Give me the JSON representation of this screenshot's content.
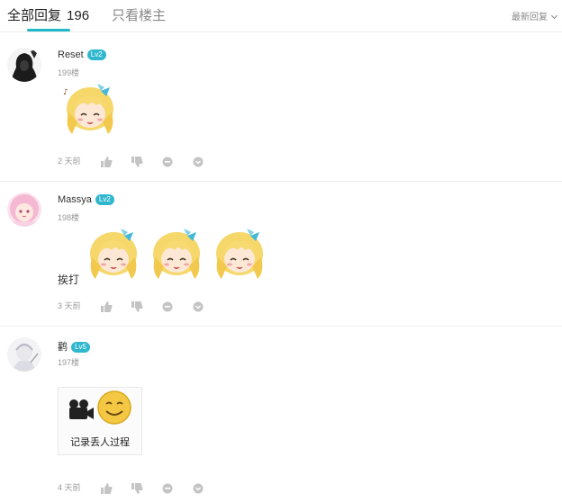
{
  "tabs": {
    "all_label": "全部回复",
    "all_count": "196",
    "owner_only_label": "只看楼主"
  },
  "sort": {
    "label": "最新回复"
  },
  "colors": {
    "accent": "#22b8c8",
    "level_badge": "#2fb7cf"
  },
  "replies": [
    {
      "username": "Reset",
      "level": "Lv2",
      "floor": "199楼",
      "text": "",
      "time": "2 天前"
    },
    {
      "username": "Massya",
      "level": "Lv2",
      "floor": "198楼",
      "text": "挨打",
      "time": "3 天前"
    },
    {
      "username": "鹳",
      "level": "Lv5",
      "floor": "197楼",
      "text": "",
      "media_caption": "记录丢人过程",
      "time": "4 天前"
    }
  ],
  "icons": [
    "like-icon",
    "dislike-icon",
    "comment-icon",
    "more-icon",
    "camera-icon",
    "chevron-down-icon"
  ]
}
